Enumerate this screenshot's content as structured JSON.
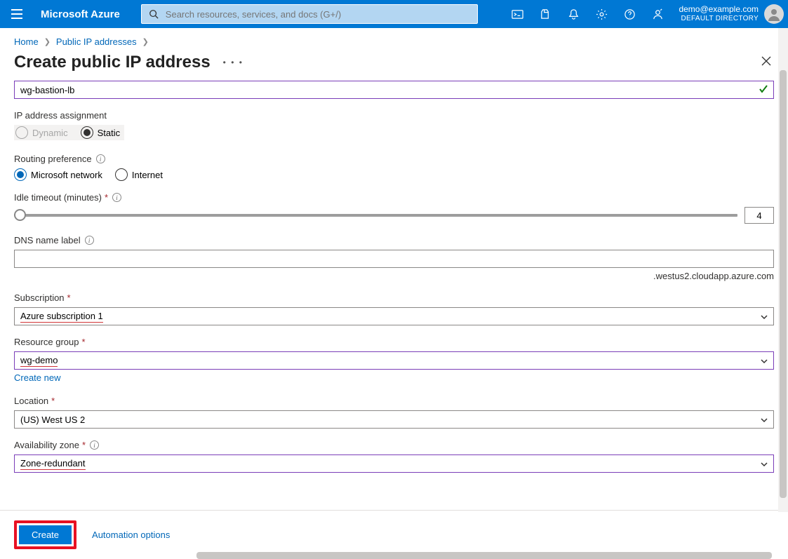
{
  "header": {
    "brand": "Microsoft Azure",
    "search_placeholder": "Search resources, services, and docs (G+/)",
    "user_email": "demo@example.com",
    "user_directory": "DEFAULT DIRECTORY"
  },
  "breadcrumb": {
    "home": "Home",
    "parent": "Public IP addresses"
  },
  "title": "Create public IP address",
  "form": {
    "name_value": "wg-bastion-lb",
    "ip_assignment": {
      "label": "IP address assignment",
      "dynamic": "Dynamic",
      "static": "Static",
      "selected": "Static"
    },
    "routing": {
      "label": "Routing preference",
      "ms": "Microsoft network",
      "internet": "Internet",
      "selected": "Microsoft network"
    },
    "idle": {
      "label": "Idle timeout (minutes)",
      "value": "4"
    },
    "dns": {
      "label": "DNS name label",
      "value": "",
      "suffix": ".westus2.cloudapp.azure.com"
    },
    "subscription": {
      "label": "Subscription",
      "value": "Azure subscription 1"
    },
    "resource_group": {
      "label": "Resource group",
      "value": "wg-demo",
      "create_new": "Create new"
    },
    "location": {
      "label": "Location",
      "value": "(US) West US 2"
    },
    "zone": {
      "label": "Availability zone",
      "value": "Zone-redundant"
    }
  },
  "footer": {
    "create": "Create",
    "automation": "Automation options"
  }
}
